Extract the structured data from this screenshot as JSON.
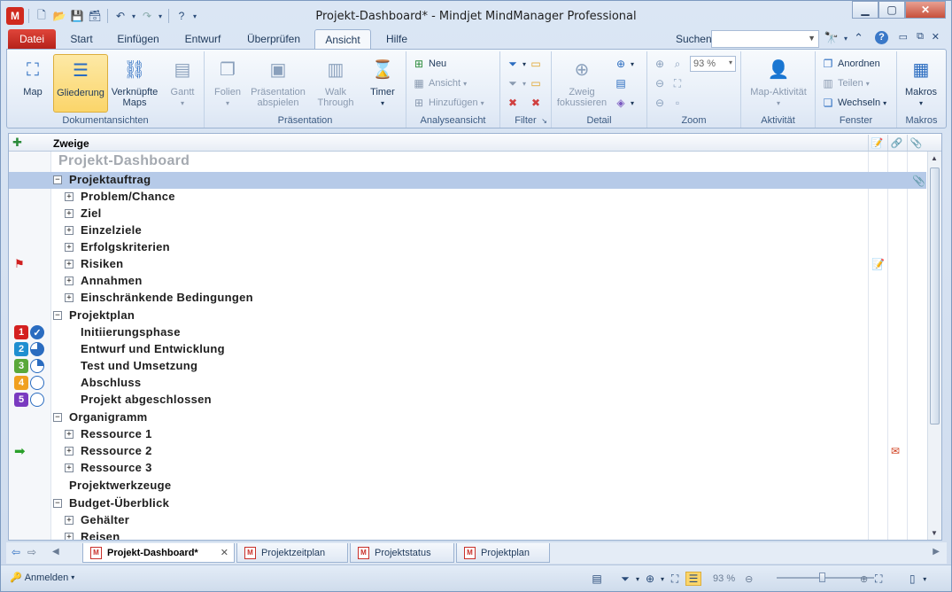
{
  "window": {
    "title": "Projekt-Dashboard* - Mindjet MindManager Professional"
  },
  "ribbon_tabs": [
    "Datei",
    "Start",
    "Einfügen",
    "Entwurf",
    "Überprüfen",
    "Ansicht",
    "Hilfe"
  ],
  "search": {
    "label": "Suchen:",
    "value": ""
  },
  "ribbon": {
    "doc_views": {
      "label": "Dokumentansichten",
      "map": "Map",
      "outline": "Gliederung",
      "linked_1": "Verknüpfte",
      "linked_2": "Maps",
      "gantt": "Gantt"
    },
    "presentation": {
      "label": "Präsentation",
      "slides": "Folien",
      "play_1": "Präsentation",
      "play_2": "abspielen",
      "walk_1": "Walk",
      "walk_2": "Through",
      "timer": "Timer"
    },
    "analysis": {
      "label": "Analyseansicht",
      "new": "Neu",
      "view": "Ansicht",
      "add": "Hinzufügen"
    },
    "filter": {
      "label": "Filter"
    },
    "detail": {
      "label": "Detail",
      "focus_1": "Zweig",
      "focus_2": "fokussieren"
    },
    "zoom": {
      "label": "Zoom",
      "value": "93 %"
    },
    "activity": {
      "label": "Aktivität",
      "map_activity": "Map-Aktivität"
    },
    "window_grp": {
      "label": "Fenster",
      "arrange": "Anordnen",
      "split": "Teilen",
      "switch": "Wechseln"
    },
    "macros": {
      "label": "Makros",
      "macros": "Makros"
    }
  },
  "outline": {
    "column_header": "Zweige",
    "rows": [
      {
        "text": "Projekt-Dashboard"
      },
      {
        "text": "Projektauftrag"
      },
      {
        "text": "Problem/Chance"
      },
      {
        "text": "Ziel"
      },
      {
        "text": "Einzelziele"
      },
      {
        "text": "Erfolgskriterien"
      },
      {
        "text": "Risiken"
      },
      {
        "text": "Annahmen"
      },
      {
        "text": "Einschränkende Bedingungen"
      },
      {
        "text": "Projektplan"
      },
      {
        "text": "Initiierungsphase"
      },
      {
        "text": "Entwurf und Entwicklung"
      },
      {
        "text": "Test und Umsetzung"
      },
      {
        "text": "Abschluss"
      },
      {
        "text": "Projekt abgeschlossen"
      },
      {
        "text": "Organigramm"
      },
      {
        "text": "Ressource 1"
      },
      {
        "text": "Ressource 2"
      },
      {
        "text": "Ressource 3"
      },
      {
        "text": "Projektwerkzeuge"
      },
      {
        "text": "Budget-Überblick"
      },
      {
        "text": "Gehälter"
      },
      {
        "text": "Reisen"
      }
    ],
    "priority_numbers": [
      "1",
      "2",
      "3",
      "4",
      "5"
    ]
  },
  "doc_tabs": [
    "Projekt-Dashboard*",
    "Projektzeitplan",
    "Projektstatus",
    "Projektplan"
  ],
  "status": {
    "login": "Anmelden",
    "zoom": "93 %"
  }
}
